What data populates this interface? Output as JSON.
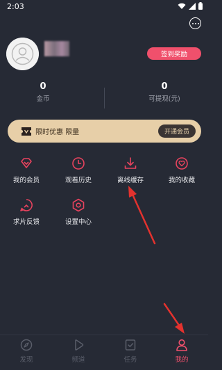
{
  "status_bar": {
    "time": "2:03"
  },
  "profile": {
    "signin_label": "签到奖励"
  },
  "stats": [
    {
      "value": "0",
      "label": "金币"
    },
    {
      "value": "0",
      "label": "可提现(元)"
    }
  ],
  "vip_banner": {
    "text": "限时优惠 限量",
    "button": "开通会员"
  },
  "menu": [
    {
      "label": "我的会员",
      "icon": "diamond-icon"
    },
    {
      "label": "观看历史",
      "icon": "clock-icon"
    },
    {
      "label": "离线缓存",
      "icon": "download-icon"
    },
    {
      "label": "我的收藏",
      "icon": "heart-icon"
    },
    {
      "label": "求片反馈",
      "icon": "feedback-icon"
    },
    {
      "label": "设置中心",
      "icon": "settings-hexagon-icon"
    }
  ],
  "bottom_nav": [
    {
      "label": "发现",
      "icon": "compass-icon",
      "active": false
    },
    {
      "label": "频道",
      "icon": "play-icon",
      "active": false
    },
    {
      "label": "任务",
      "icon": "task-icon",
      "active": false
    },
    {
      "label": "我的",
      "icon": "user-icon",
      "active": true
    }
  ],
  "colors": {
    "background": "#262a35",
    "accent": "#f0506c",
    "vip_gold": "#e7cfa8",
    "muted": "#5a5e6a"
  }
}
